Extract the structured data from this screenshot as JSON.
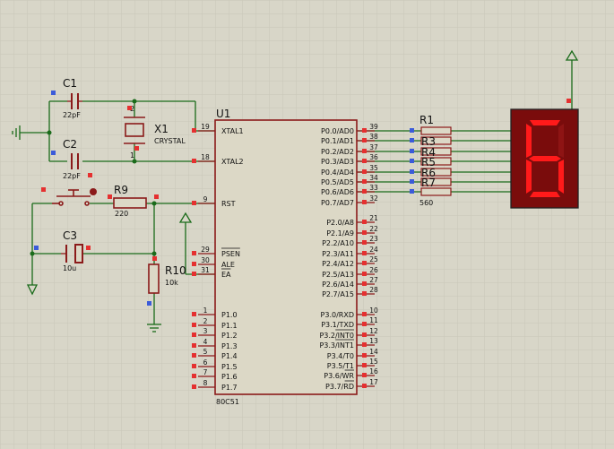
{
  "colors": {
    "background": "#d8d6c8",
    "grid": "#c9c7b8",
    "wire": "#1a6b1a",
    "component": "#8b1a1a",
    "chip_fill": "#dcd8c6",
    "pin_red": "#e53030",
    "pin_blue": "#3b5bd9",
    "display_bg": "#7a0c0c",
    "segment_on": "#ff1a1a",
    "segment_off": "#8e1414"
  },
  "mcu": {
    "ref": "U1",
    "part": "80C51",
    "left_pins": [
      {
        "num": "19",
        "name": "XTAL1"
      },
      {
        "num": "18",
        "name": "XTAL2"
      },
      {
        "num": "9",
        "name": "RST"
      },
      {
        "num": "29",
        "name": "PSEN"
      },
      {
        "num": "30",
        "name": "ALE"
      },
      {
        "num": "31",
        "name": "EA"
      },
      {
        "num": "1",
        "name": "P1.0"
      },
      {
        "num": "2",
        "name": "P1.1"
      },
      {
        "num": "3",
        "name": "P1.2"
      },
      {
        "num": "4",
        "name": "P1.3"
      },
      {
        "num": "5",
        "name": "P1.4"
      },
      {
        "num": "6",
        "name": "P1.5"
      },
      {
        "num": "7",
        "name": "P1.6"
      },
      {
        "num": "8",
        "name": "P1.7"
      }
    ],
    "right_pins": [
      {
        "num": "39",
        "name": "P0.0/AD0"
      },
      {
        "num": "38",
        "name": "P0.1/AD1"
      },
      {
        "num": "37",
        "name": "P0.2/AD2"
      },
      {
        "num": "36",
        "name": "P0.3/AD3"
      },
      {
        "num": "35",
        "name": "P0.4/AD4"
      },
      {
        "num": "34",
        "name": "P0.5/AD5"
      },
      {
        "num": "33",
        "name": "P0.6/AD6"
      },
      {
        "num": "32",
        "name": "P0.7/AD7"
      },
      {
        "num": "21",
        "name": "P2.0/A8"
      },
      {
        "num": "22",
        "name": "P2.1/A9"
      },
      {
        "num": "23",
        "name": "P2.2/A10"
      },
      {
        "num": "24",
        "name": "P2.3/A11"
      },
      {
        "num": "25",
        "name": "P2.4/A12"
      },
      {
        "num": "26",
        "name": "P2.5/A13"
      },
      {
        "num": "27",
        "name": "P2.6/A14"
      },
      {
        "num": "28",
        "name": "P2.7/A15"
      },
      {
        "num": "10",
        "name": "P3.0/RXD"
      },
      {
        "num": "11",
        "name": "P3.1/TXD"
      },
      {
        "num": "12",
        "name": "P3.2/INT0"
      },
      {
        "num": "13",
        "name": "P3.3/INT1"
      },
      {
        "num": "14",
        "name": "P3.4/T0"
      },
      {
        "num": "15",
        "name": "P3.5/T1"
      },
      {
        "num": "16",
        "name": "P3.6/WR"
      },
      {
        "num": "17",
        "name": "P3.7/RD"
      }
    ]
  },
  "components": {
    "c1": {
      "ref": "C1",
      "value": "22pF"
    },
    "c2": {
      "ref": "C2",
      "value": "22pF"
    },
    "x1": {
      "ref": "X1",
      "value": "CRYSTAL",
      "pin1": "1",
      "pin2": "2"
    },
    "c3": {
      "ref": "C3",
      "value": "10u"
    },
    "r9": {
      "ref": "R9",
      "value": "220"
    },
    "r10": {
      "ref": "R10",
      "value": "10k"
    },
    "rpack": {
      "ref": "R1",
      "value": "560",
      "extra_refs": [
        "R3",
        "R4",
        "R5",
        "R6",
        "R7"
      ]
    }
  },
  "display": {
    "digit": "6",
    "segments_on": [
      "a",
      "c",
      "d",
      "e",
      "f",
      "g"
    ]
  }
}
